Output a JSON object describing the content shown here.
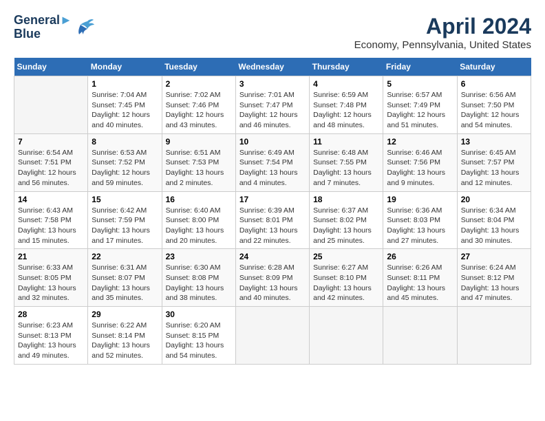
{
  "header": {
    "logo_line1": "General",
    "logo_line2": "Blue",
    "main_title": "April 2024",
    "subtitle": "Economy, Pennsylvania, United States"
  },
  "calendar": {
    "days_of_week": [
      "Sunday",
      "Monday",
      "Tuesday",
      "Wednesday",
      "Thursday",
      "Friday",
      "Saturday"
    ],
    "weeks": [
      [
        {
          "day": "",
          "info": ""
        },
        {
          "day": "1",
          "info": "Sunrise: 7:04 AM\nSunset: 7:45 PM\nDaylight: 12 hours\nand 40 minutes."
        },
        {
          "day": "2",
          "info": "Sunrise: 7:02 AM\nSunset: 7:46 PM\nDaylight: 12 hours\nand 43 minutes."
        },
        {
          "day": "3",
          "info": "Sunrise: 7:01 AM\nSunset: 7:47 PM\nDaylight: 12 hours\nand 46 minutes."
        },
        {
          "day": "4",
          "info": "Sunrise: 6:59 AM\nSunset: 7:48 PM\nDaylight: 12 hours\nand 48 minutes."
        },
        {
          "day": "5",
          "info": "Sunrise: 6:57 AM\nSunset: 7:49 PM\nDaylight: 12 hours\nand 51 minutes."
        },
        {
          "day": "6",
          "info": "Sunrise: 6:56 AM\nSunset: 7:50 PM\nDaylight: 12 hours\nand 54 minutes."
        }
      ],
      [
        {
          "day": "7",
          "info": "Sunrise: 6:54 AM\nSunset: 7:51 PM\nDaylight: 12 hours\nand 56 minutes."
        },
        {
          "day": "8",
          "info": "Sunrise: 6:53 AM\nSunset: 7:52 PM\nDaylight: 12 hours\nand 59 minutes."
        },
        {
          "day": "9",
          "info": "Sunrise: 6:51 AM\nSunset: 7:53 PM\nDaylight: 13 hours\nand 2 minutes."
        },
        {
          "day": "10",
          "info": "Sunrise: 6:49 AM\nSunset: 7:54 PM\nDaylight: 13 hours\nand 4 minutes."
        },
        {
          "day": "11",
          "info": "Sunrise: 6:48 AM\nSunset: 7:55 PM\nDaylight: 13 hours\nand 7 minutes."
        },
        {
          "day": "12",
          "info": "Sunrise: 6:46 AM\nSunset: 7:56 PM\nDaylight: 13 hours\nand 9 minutes."
        },
        {
          "day": "13",
          "info": "Sunrise: 6:45 AM\nSunset: 7:57 PM\nDaylight: 13 hours\nand 12 minutes."
        }
      ],
      [
        {
          "day": "14",
          "info": "Sunrise: 6:43 AM\nSunset: 7:58 PM\nDaylight: 13 hours\nand 15 minutes."
        },
        {
          "day": "15",
          "info": "Sunrise: 6:42 AM\nSunset: 7:59 PM\nDaylight: 13 hours\nand 17 minutes."
        },
        {
          "day": "16",
          "info": "Sunrise: 6:40 AM\nSunset: 8:00 PM\nDaylight: 13 hours\nand 20 minutes."
        },
        {
          "day": "17",
          "info": "Sunrise: 6:39 AM\nSunset: 8:01 PM\nDaylight: 13 hours\nand 22 minutes."
        },
        {
          "day": "18",
          "info": "Sunrise: 6:37 AM\nSunset: 8:02 PM\nDaylight: 13 hours\nand 25 minutes."
        },
        {
          "day": "19",
          "info": "Sunrise: 6:36 AM\nSunset: 8:03 PM\nDaylight: 13 hours\nand 27 minutes."
        },
        {
          "day": "20",
          "info": "Sunrise: 6:34 AM\nSunset: 8:04 PM\nDaylight: 13 hours\nand 30 minutes."
        }
      ],
      [
        {
          "day": "21",
          "info": "Sunrise: 6:33 AM\nSunset: 8:05 PM\nDaylight: 13 hours\nand 32 minutes."
        },
        {
          "day": "22",
          "info": "Sunrise: 6:31 AM\nSunset: 8:07 PM\nDaylight: 13 hours\nand 35 minutes."
        },
        {
          "day": "23",
          "info": "Sunrise: 6:30 AM\nSunset: 8:08 PM\nDaylight: 13 hours\nand 38 minutes."
        },
        {
          "day": "24",
          "info": "Sunrise: 6:28 AM\nSunset: 8:09 PM\nDaylight: 13 hours\nand 40 minutes."
        },
        {
          "day": "25",
          "info": "Sunrise: 6:27 AM\nSunset: 8:10 PM\nDaylight: 13 hours\nand 42 minutes."
        },
        {
          "day": "26",
          "info": "Sunrise: 6:26 AM\nSunset: 8:11 PM\nDaylight: 13 hours\nand 45 minutes."
        },
        {
          "day": "27",
          "info": "Sunrise: 6:24 AM\nSunset: 8:12 PM\nDaylight: 13 hours\nand 47 minutes."
        }
      ],
      [
        {
          "day": "28",
          "info": "Sunrise: 6:23 AM\nSunset: 8:13 PM\nDaylight: 13 hours\nand 49 minutes."
        },
        {
          "day": "29",
          "info": "Sunrise: 6:22 AM\nSunset: 8:14 PM\nDaylight: 13 hours\nand 52 minutes."
        },
        {
          "day": "30",
          "info": "Sunrise: 6:20 AM\nSunset: 8:15 PM\nDaylight: 13 hours\nand 54 minutes."
        },
        {
          "day": "",
          "info": ""
        },
        {
          "day": "",
          "info": ""
        },
        {
          "day": "",
          "info": ""
        },
        {
          "day": "",
          "info": ""
        }
      ]
    ]
  }
}
